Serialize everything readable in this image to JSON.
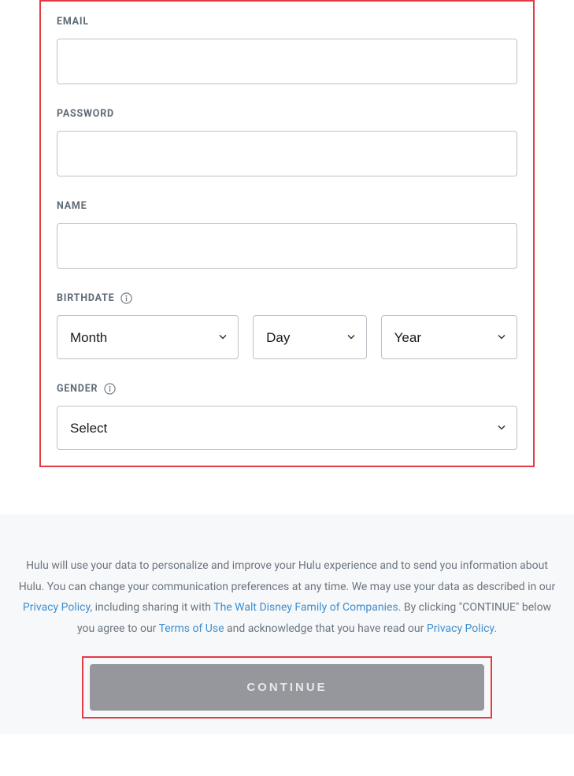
{
  "form": {
    "email": {
      "label": "EMAIL",
      "value": ""
    },
    "password": {
      "label": "PASSWORD",
      "value": ""
    },
    "name": {
      "label": "NAME",
      "value": ""
    },
    "birthdate": {
      "label": "BIRTHDATE",
      "month": "Month",
      "day": "Day",
      "year": "Year"
    },
    "gender": {
      "label": "GENDER",
      "selected": "Select"
    }
  },
  "legal": {
    "text1": "Hulu will use your data to personalize and improve your Hulu experience and to send you information about Hulu. You can change your communication preferences at any time. We may use your data as described in our ",
    "privacy1": "Privacy Policy",
    "text2": ", including sharing it with ",
    "disney": "The Walt Disney Family of Companies",
    "text3": ". By clicking \"CONTINUE\" below you agree to our ",
    "terms": "Terms of Use",
    "text4": " and acknowledge that you have read our ",
    "privacy2": "Privacy Policy",
    "text5": "."
  },
  "button": {
    "continue": "CONTINUE"
  }
}
